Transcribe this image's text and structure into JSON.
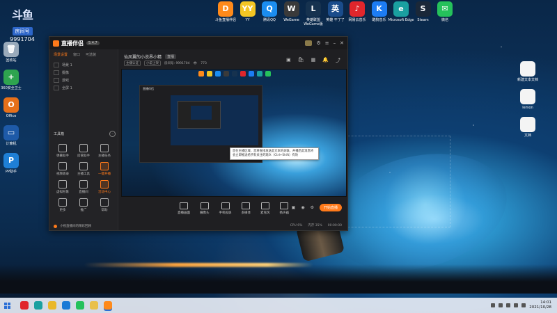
{
  "desktop": {
    "douyu": {
      "brand": "斗鱼",
      "room_label": "房间号",
      "room_number": "9991704"
    },
    "top_icons": [
      {
        "label": "斗鱼直播伴侣",
        "color": "#ff8a1a",
        "glyph": "D"
      },
      {
        "label": "YY",
        "color": "#f3c623",
        "glyph": "YY"
      },
      {
        "label": "腾讯QQ",
        "color": "#1b8df0",
        "glyph": "Q"
      },
      {
        "label": "WeGame",
        "color": "#3a3a3a",
        "glyph": "W"
      },
      {
        "label": "英雄联盟 WeGame版",
        "color": "#16324f",
        "glyph": "L"
      },
      {
        "label": "英雄 不了了",
        "color": "#1a4c8b",
        "glyph": "英"
      },
      {
        "label": "网易云音乐",
        "color": "#e0262c",
        "glyph": "♪"
      },
      {
        "label": "酷狗音乐",
        "color": "#1c7cf3",
        "glyph": "K"
      },
      {
        "label": "Microsoft Edge",
        "color": "#1aa0a0",
        "glyph": "e"
      },
      {
        "label": "Steam",
        "color": "#1b2838",
        "glyph": "S"
      },
      {
        "label": "微信",
        "color": "#25c15b",
        "glyph": "✉"
      }
    ],
    "left_icons": [
      {
        "label": "回收站",
        "color": "#9ab",
        "glyph": "🗑"
      },
      {
        "label": "360安全卫士",
        "color": "#2ea44f",
        "glyph": "+"
      },
      {
        "label": "Office",
        "color": "#e6701a",
        "glyph": "O"
      },
      {
        "label": "计算机",
        "color": "#1e5aa8",
        "glyph": "▭"
      },
      {
        "label": "PP助手",
        "color": "#1e7fd6",
        "glyph": "P"
      }
    ],
    "right_icons": [
      {
        "label": "新建文本文档",
        "color": "#f4f4f4",
        "glyph": ""
      },
      {
        "label": "lemon",
        "color": "#f4f4f4",
        "glyph": ""
      },
      {
        "label": "文档",
        "color": "#f4f4f4",
        "glyph": ""
      }
    ]
  },
  "app": {
    "title": "直播伴侣",
    "version": "5.4.7",
    "sidebar": {
      "tabs": [
        "场景设置",
        "窗口",
        "可选装"
      ],
      "scenes": [
        "场景 1",
        "摄像",
        "游戏",
        "全屏 1"
      ],
      "tools_title": "工具箱",
      "tools": [
        {
          "label": "弹幕助手",
          "highlight": false
        },
        {
          "label": "房管助手",
          "highlight": false
        },
        {
          "label": "主播任务",
          "highlight": false
        },
        {
          "label": "视频收录",
          "highlight": false
        },
        {
          "label": "主播工具",
          "highlight": false
        },
        {
          "label": "一键开播",
          "highlight": true
        },
        {
          "label": "虚拟形象",
          "highlight": false
        },
        {
          "label": "直播间",
          "highlight": false
        },
        {
          "label": "活动中心",
          "highlight": true
        },
        {
          "label": "更多",
          "highlight": false
        },
        {
          "label": "推广",
          "highlight": false
        },
        {
          "label": "帮助",
          "highlight": false
        }
      ],
      "footer": "小视直播间的精彩回顾"
    },
    "room": {
      "title": "仙凤翼的小说界小精",
      "tag": "直播",
      "meta_chip1": "主播认证",
      "meta_chip2": "小说上架",
      "meta_text": "房间号: 9991704",
      "viewers": "773"
    },
    "tooltip": "您在主播区域、您将直接发送此文本的关联，开播后此消息将会立即推送给所有关注的观众（Ctrl+Shift）有效",
    "controls": [
      {
        "label": "直播画面"
      },
      {
        "label": "摄像头"
      },
      {
        "label": "手机投屏"
      },
      {
        "label": "多媒体"
      },
      {
        "label": "麦克风"
      },
      {
        "label": "扬声器"
      }
    ],
    "live_button": "开始直播",
    "status": [
      "CPU 6%",
      "内存 35%",
      "00:00:00"
    ]
  },
  "taskbar": {
    "apps": [
      {
        "name": "网易云音乐",
        "color": "#e0262c"
      },
      {
        "name": "Edge",
        "color": "#1aa0a0"
      },
      {
        "name": "Chrome",
        "color": "#e9b82a"
      },
      {
        "name": "Edge2",
        "color": "#1a7ad6"
      },
      {
        "name": "微信",
        "color": "#25c15b"
      },
      {
        "name": "文件",
        "color": "#e9c04a"
      },
      {
        "name": "斗鱼直播伴侣",
        "color": "#ff8a1a"
      }
    ],
    "time": "14:01",
    "date": "2021/10/28"
  }
}
